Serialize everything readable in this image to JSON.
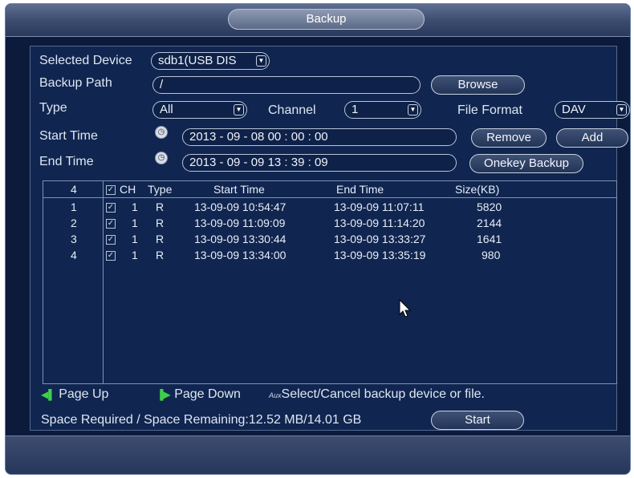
{
  "window": {
    "title": "Backup"
  },
  "form": {
    "selected_device_label": "Selected Device",
    "selected_device_value": "sdb1(USB DIS",
    "backup_path_label": "Backup Path",
    "backup_path_value": "/",
    "browse_label": "Browse",
    "type_label": "Type",
    "type_value": "All",
    "channel_label": "Channel",
    "channel_value": "1",
    "file_format_label": "File Format",
    "file_format_value": "DAV",
    "start_time_label": "Start Time",
    "start_time_value": "2013  -  09  -  08     00  :  00  :  00",
    "end_time_label": "End Time",
    "end_time_value": "2013  -  09  -  09     13  :  39  :  09",
    "remove_label": "Remove",
    "add_label": "Add",
    "onekey_label": "Onekey Backup"
  },
  "table": {
    "count": "4",
    "headers": {
      "ch": "CH",
      "type": "Type",
      "start": "Start Time",
      "end": "End Time",
      "size": "Size(KB)"
    },
    "rows": [
      {
        "no": "1",
        "ch": "1",
        "type": "R",
        "start": "13-09-09 10:54:47",
        "end": "13-09-09 11:07:11",
        "size": "5820"
      },
      {
        "no": "2",
        "ch": "1",
        "type": "R",
        "start": "13-09-09 11:09:09",
        "end": "13-09-09 11:14:20",
        "size": "2144"
      },
      {
        "no": "3",
        "ch": "1",
        "type": "R",
        "start": "13-09-09 13:30:44",
        "end": "13-09-09 13:33:27",
        "size": "1641"
      },
      {
        "no": "4",
        "ch": "1",
        "type": "R",
        "start": "13-09-09 13:34:00",
        "end": "13-09-09 13:35:19",
        "size": "980"
      }
    ]
  },
  "hints": {
    "page_up": "Page Up",
    "page_down": "Page Down",
    "aux": "Aux",
    "select_cancel": "Select/Cancel backup device or file."
  },
  "status": {
    "space_text": "Space Required / Space Remaining:12.52 MB/14.01 GB",
    "start_label": "Start"
  },
  "colors": {
    "background": "#0c1a3c",
    "accent_green": "#3fd04a"
  }
}
